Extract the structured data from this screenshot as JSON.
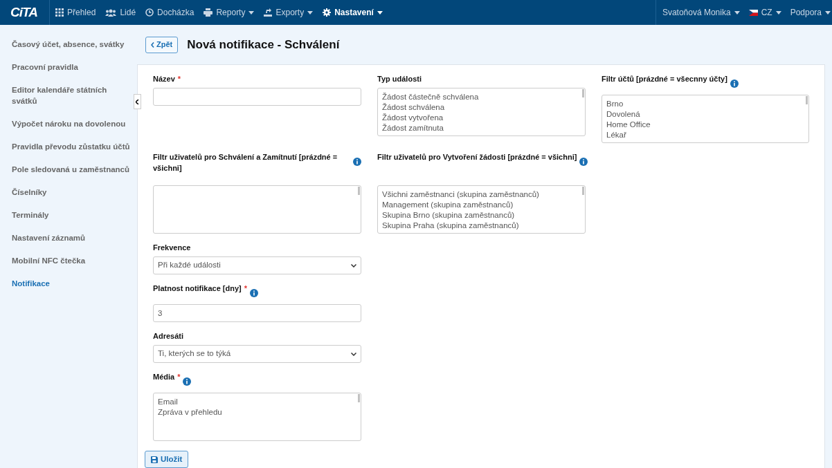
{
  "nav": {
    "logo": "CiTA",
    "items": [
      {
        "label": "Přehled",
        "caret": false,
        "selected": false
      },
      {
        "label": "Lidé",
        "caret": false,
        "selected": false
      },
      {
        "label": "Docházka",
        "caret": false,
        "selected": false
      },
      {
        "label": "Reporty",
        "caret": true,
        "selected": false
      },
      {
        "label": "Exporty",
        "caret": true,
        "selected": false
      },
      {
        "label": "Nastavení",
        "caret": true,
        "selected": true
      }
    ],
    "right": [
      {
        "label": "Svatoňová Monika",
        "flag": false
      },
      {
        "label": "CZ",
        "flag": true
      },
      {
        "label": "Podpora",
        "flag": false
      }
    ]
  },
  "sidebar": {
    "items": [
      {
        "label": "Časový účet, absence, svátky",
        "selected": false
      },
      {
        "label": "Pracovní pravidla",
        "selected": false
      },
      {
        "label": "Editor kalendáře státních svátků",
        "selected": false
      },
      {
        "label": "Výpočet nároku na dovolenou",
        "selected": false
      },
      {
        "label": "Pravidla převodu zůstatku účtů",
        "selected": false
      },
      {
        "label": "Pole sledovaná u zaměstnanců",
        "selected": false
      },
      {
        "label": "Číselníky",
        "selected": false
      },
      {
        "label": "Terminály",
        "selected": false
      },
      {
        "label": "Nastavení záznamů",
        "selected": false
      },
      {
        "label": "Mobilní NFC čtečka",
        "selected": false
      },
      {
        "label": "Notifikace",
        "selected": true
      }
    ]
  },
  "header": {
    "back_button": "Zpět",
    "title": "Nová notifikace - Schválení"
  },
  "form": {
    "rows": [
      [
        {
          "kind": "text",
          "label": "Název",
          "required_mark": "*",
          "info": false
        },
        {
          "kind": "listbox",
          "label": "Typ události",
          "info": false,
          "options": [
            "Žádost částečně schválena",
            "Žádost schválena",
            "Žádost vytvořena",
            "Žádost zamítnuta"
          ]
        },
        {
          "kind": "listbox",
          "label": "Filtr účtů [prázdné = všecnny účty]",
          "info": true,
          "options": [
            "Brno",
            "Dovolená",
            "Home Office",
            "Lékař"
          ]
        }
      ],
      [
        {
          "kind": "listbox",
          "label": "Filtr uživatelů pro Schválení a Zamítnutí [prázdné = všichni]",
          "info": true
        },
        {
          "kind": "listbox",
          "label": "Filtr uživatelů pro Vytvoření žádosti [prázdné = všichni]",
          "info": true,
          "options": [
            "Všichni zaměstnanci (skupina zaměstnanců)",
            "Management (skupina zaměstnanců)",
            "Skupina Brno (skupina zaměstnanců)",
            "Skupina Praha (skupina zaměstnanců)"
          ]
        }
      ],
      [
        {
          "kind": "select",
          "label": "Frekvence",
          "info": false,
          "value": "Při každé události"
        }
      ],
      [
        {
          "kind": "text",
          "label": "Platnost notifikace [dny]",
          "required_mark": "*",
          "info": true,
          "value": "3"
        }
      ],
      [
        {
          "kind": "select",
          "label": "Adresáti",
          "info": false,
          "value": "Ti, kterých se to týká"
        }
      ],
      [
        {
          "kind": "listbox",
          "label": "Média",
          "required_mark": "*",
          "info": true,
          "options": [
            "Email",
            "Zpráva v přehledu"
          ]
        }
      ]
    ],
    "save_button": "Uložit"
  }
}
